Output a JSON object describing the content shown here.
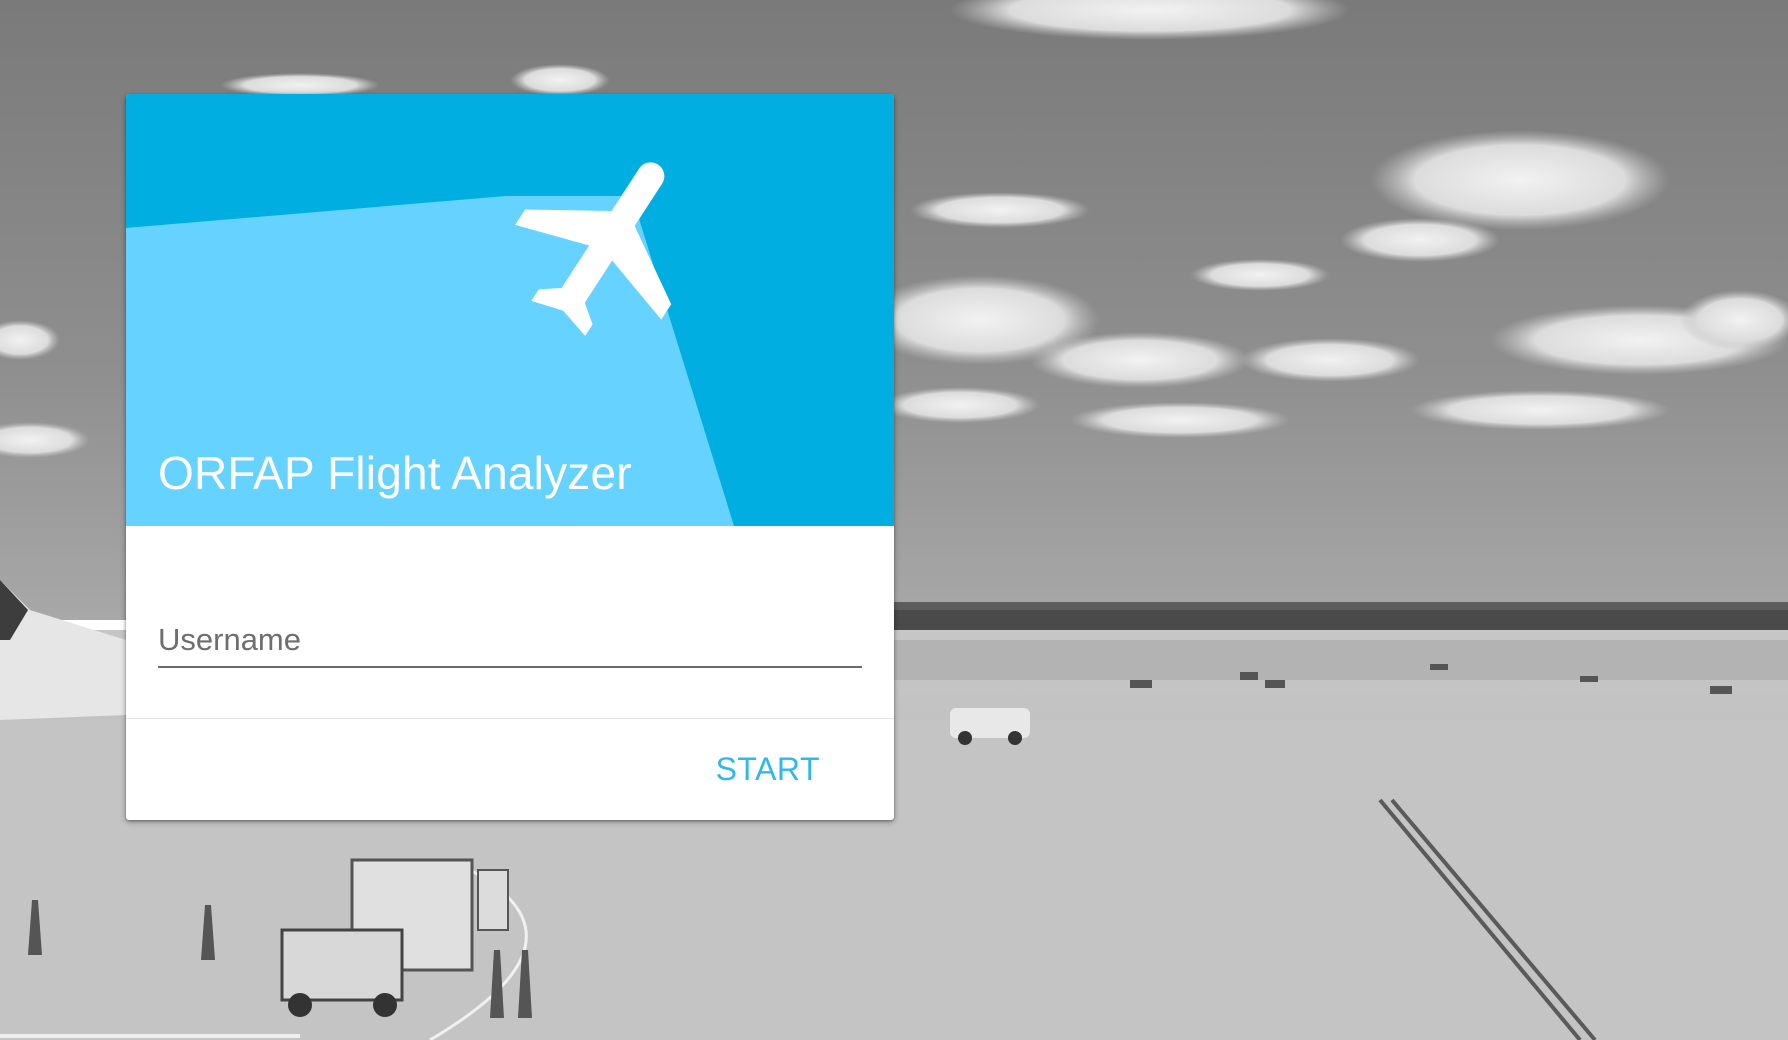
{
  "app": {
    "title": "ORFAP Flight Analyzer"
  },
  "login": {
    "username": {
      "placeholder": "Username",
      "value": ""
    },
    "start_label": "START"
  },
  "icons": {
    "header": "airplane-icon"
  },
  "colors": {
    "header_background": "#00aee1",
    "header_beam": "#66d2ff",
    "accent": "#31b8ea",
    "card_background": "#ffffff"
  }
}
